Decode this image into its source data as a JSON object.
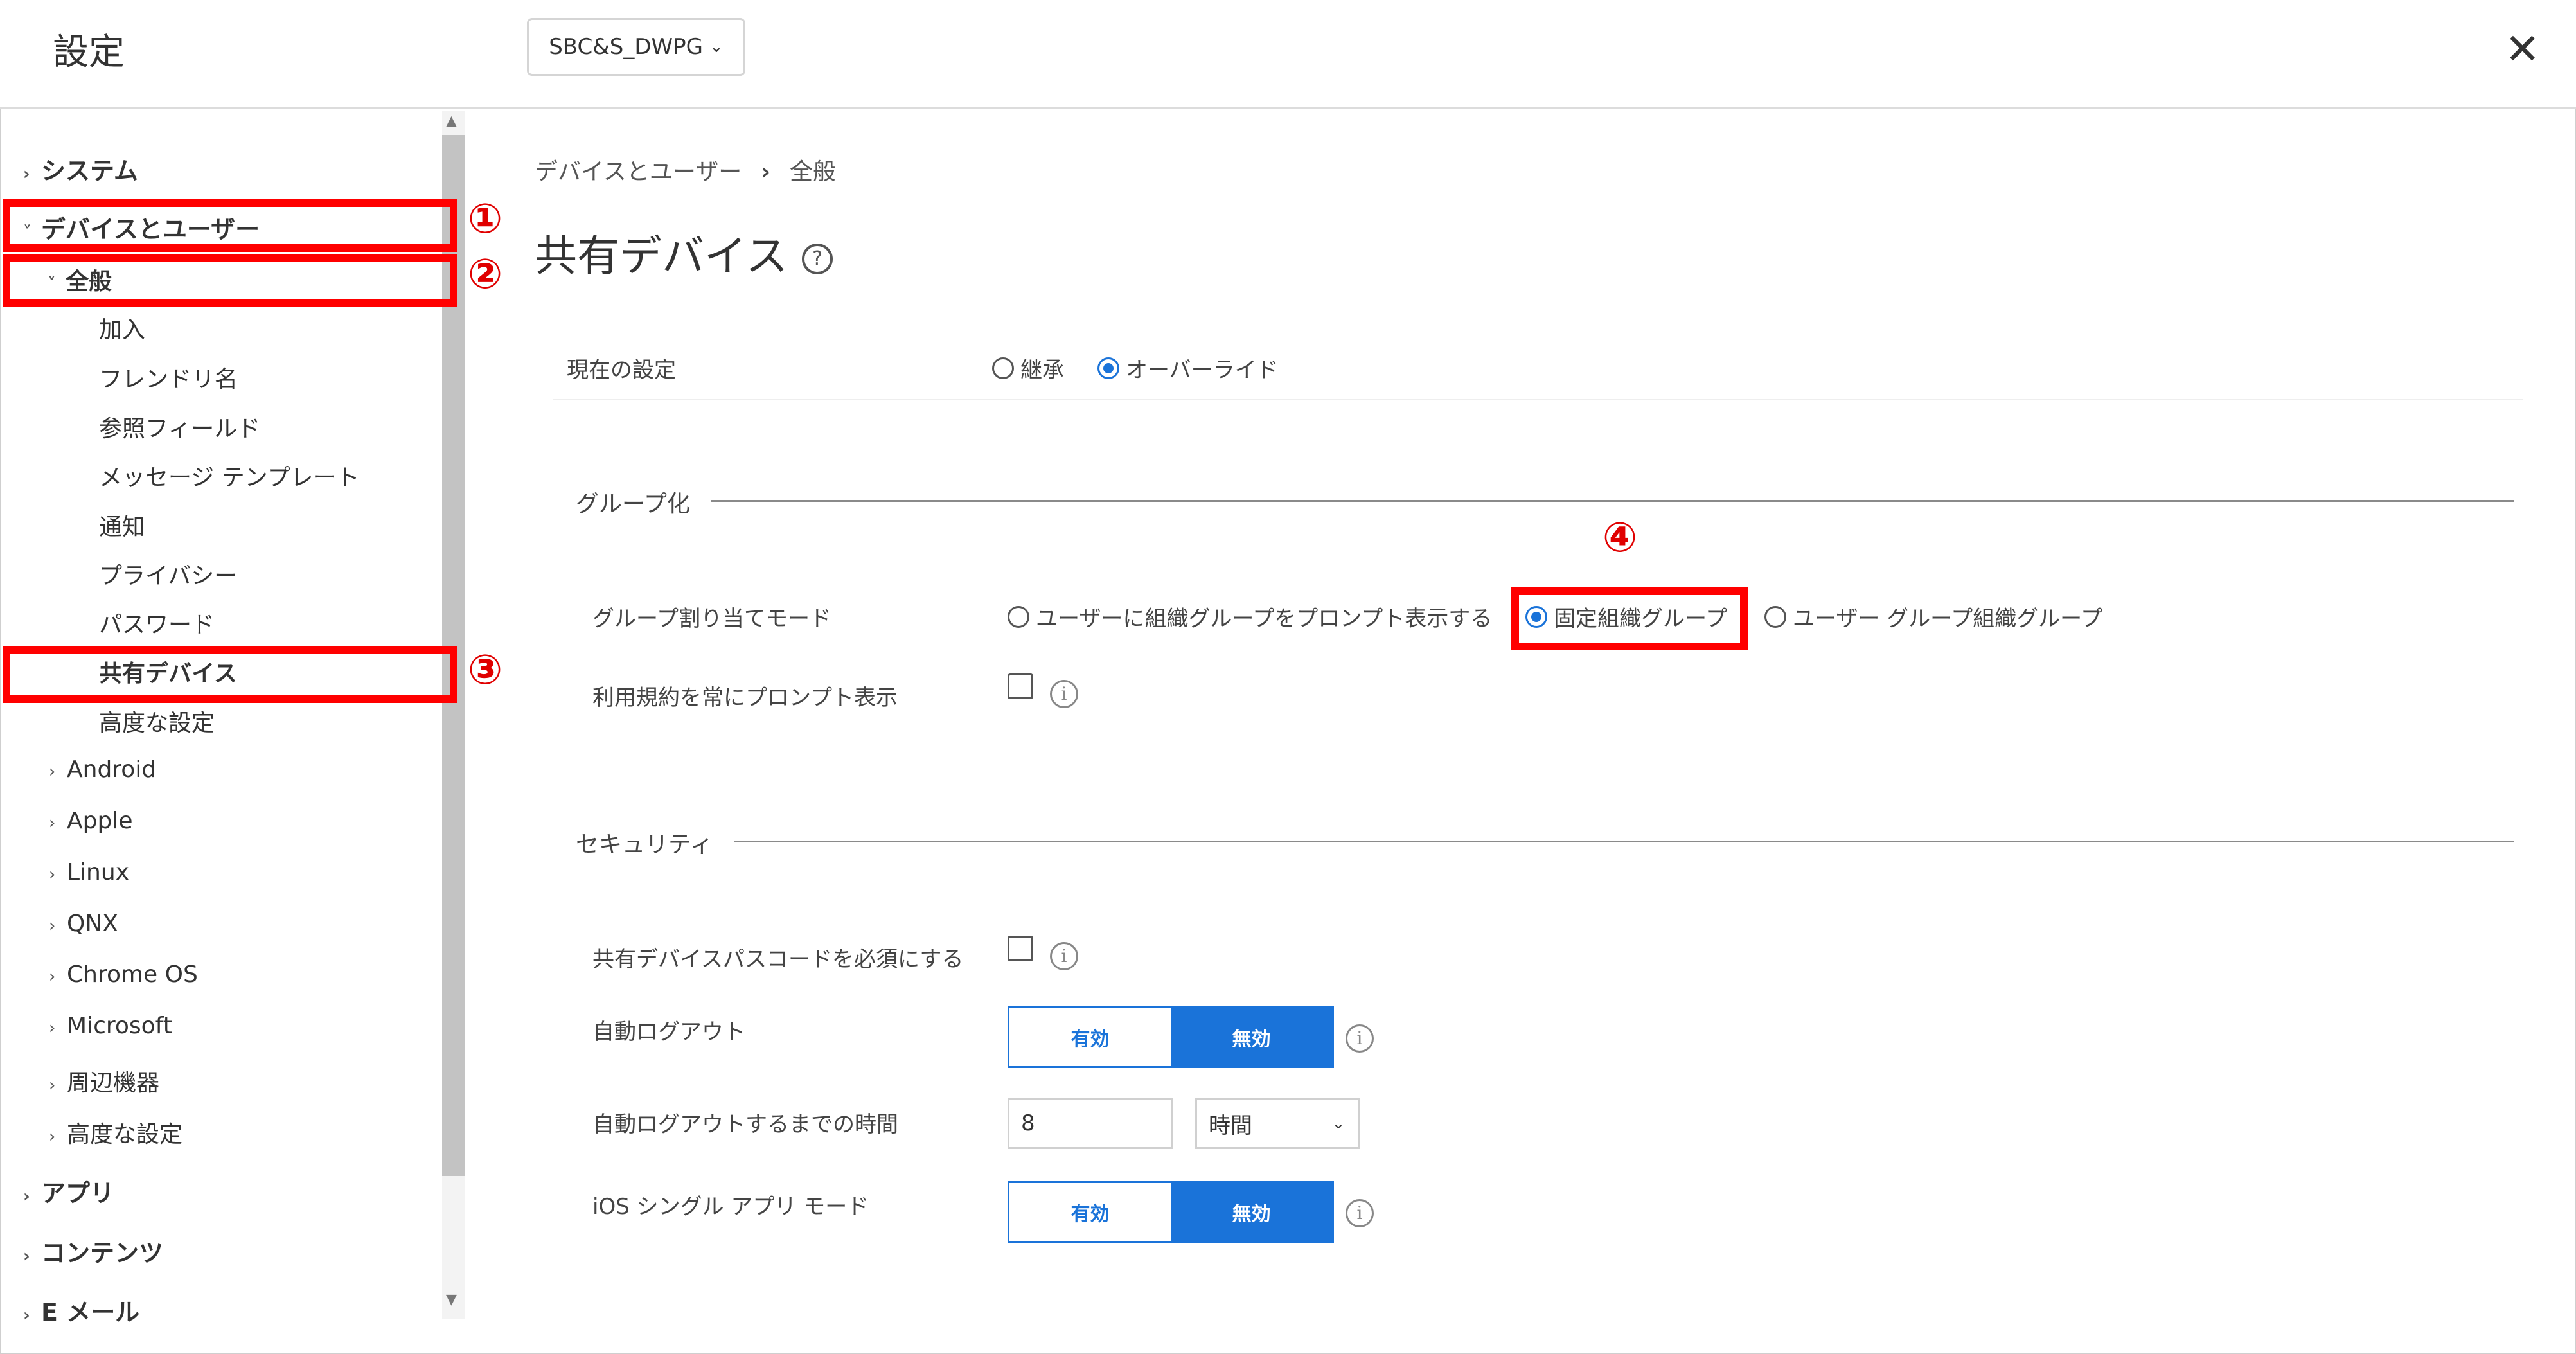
{
  "header": {
    "title": "設定",
    "org_selector": "SBC&S_DWPG",
    "close_glyph": "✕"
  },
  "sidebar": {
    "items": [
      {
        "label": "システム",
        "level": 0,
        "chevron": "›"
      },
      {
        "label": "デバイスとユーザー",
        "level": 0,
        "chevron": "˅"
      },
      {
        "label": "全般",
        "level": 1,
        "chevron": "˅"
      },
      {
        "label": "加入",
        "level": 2
      },
      {
        "label": "フレンドリ名",
        "level": 2
      },
      {
        "label": "参照フィールド",
        "level": 2
      },
      {
        "label": "メッセージ テンプレート",
        "level": 2
      },
      {
        "label": "通知",
        "level": 2
      },
      {
        "label": "プライバシー",
        "level": 2
      },
      {
        "label": "パスワード",
        "level": 2
      },
      {
        "label": "共有デバイス",
        "level": 2,
        "selected": true
      },
      {
        "label": "高度な設定",
        "level": 2
      },
      {
        "label": "Android",
        "level": 1,
        "chevron": "›"
      },
      {
        "label": "Apple",
        "level": 1,
        "chevron": "›"
      },
      {
        "label": "Linux",
        "level": 1,
        "chevron": "›"
      },
      {
        "label": "QNX",
        "level": 1,
        "chevron": "›"
      },
      {
        "label": "Chrome OS",
        "level": 1,
        "chevron": "›"
      },
      {
        "label": "Microsoft",
        "level": 1,
        "chevron": "›"
      },
      {
        "label": "周辺機器",
        "level": 1,
        "chevron": "›"
      },
      {
        "label": "高度な設定",
        "level": 1,
        "chevron": "›"
      },
      {
        "label": "アプリ",
        "level": 0,
        "chevron": "›"
      },
      {
        "label": "コンテンツ",
        "level": 0,
        "chevron": "›"
      },
      {
        "label": "E メール",
        "level": 0,
        "chevron": "›"
      }
    ]
  },
  "annotations": [
    "①",
    "②",
    "③",
    "④"
  ],
  "main": {
    "breadcrumb": [
      "デバイスとユーザー",
      "全般"
    ],
    "breadcrumb_sep": "›",
    "page_title": "共有デバイス",
    "help_glyph": "?",
    "current_setting": {
      "label": "現在の設定",
      "options": [
        "継承",
        "オーバーライド"
      ],
      "selected": "オーバーライド"
    },
    "grouping": {
      "section_title": "グループ化",
      "mode_label": "グループ割り当てモード",
      "mode_options": [
        "ユーザーに組織グループをプロンプト表示する",
        "固定組織グループ",
        "ユーザー グループ組織グループ"
      ],
      "mode_selected": "固定組織グループ",
      "terms_label": "利用規約を常にプロンプト表示",
      "terms_checked": false
    },
    "security": {
      "section_title": "セキュリティ",
      "passcode_label": "共有デバイスパスコードを必須にする",
      "passcode_checked": false,
      "auto_logout_label": "自動ログアウト",
      "auto_logout": {
        "on": "有効",
        "off": "無効",
        "selected": "無効"
      },
      "timeout_label": "自動ログアウトするまでの時間",
      "timeout_value": "8",
      "timeout_unit": "時間",
      "ios_label": "iOS シングル アプリ モード",
      "ios_mode": {
        "on": "有効",
        "off": "無効",
        "selected": "無効"
      }
    }
  },
  "colors": {
    "accent": "#1a73d9",
    "annotation": "#ff0000"
  }
}
